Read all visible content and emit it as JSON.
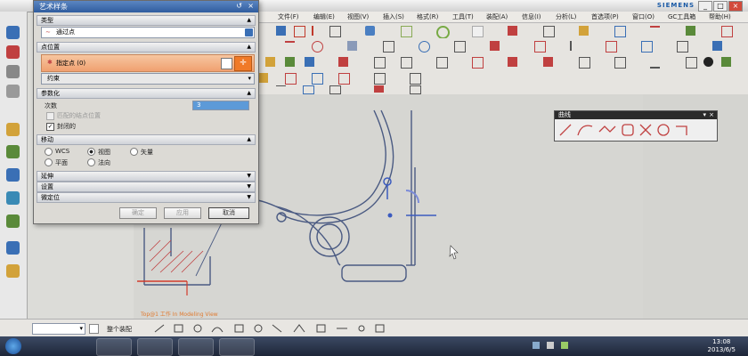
{
  "window": {
    "brand": "SIEMENS",
    "min_label": "_",
    "max_label": "□",
    "close_label": "×"
  },
  "menubar": {
    "items": [
      "文件(F)",
      "编辑(E)",
      "视图(V)",
      "插入(S)",
      "格式(R)",
      "工具(T)",
      "装配(A)",
      "信息(I)",
      "分析(L)",
      "首选项(P)",
      "窗口(O)",
      "GC工具箱",
      "帮助(H)"
    ]
  },
  "dialog": {
    "title": "艺术样条",
    "type_section": "类型",
    "type_value": "通过点",
    "points_section": "点位置",
    "point_label": "指定点 (0)",
    "constraint_value": "约束",
    "params_section": "参数化",
    "degree_label": "次数",
    "degree_value": "3",
    "matched_knot_label": "匹配的结点位置",
    "closed_label": "封闭的",
    "move_section": "移动",
    "move_options": [
      "WCS",
      "视图",
      "矢量",
      "平面",
      "法向"
    ],
    "extension_section": "延伸",
    "settings_section": "设置",
    "preview_section": "微定位",
    "ok_label": "确定",
    "apply_label": "应用",
    "cancel_label": "取消"
  },
  "curve_palette": {
    "title": "曲线"
  },
  "canvas": {
    "status_text": "Top@1 工作 In Modeling View"
  },
  "selbar": {
    "filter_value": "",
    "label": "整个装配"
  },
  "clock": {
    "time": "13:08",
    "date": "2013/6/5"
  },
  "colors": {
    "title_blue": "#2f5c9e",
    "highlight_orange": "#f07a28",
    "geometry": "#4a5a82",
    "palette_dark": "#2b2b2b"
  }
}
